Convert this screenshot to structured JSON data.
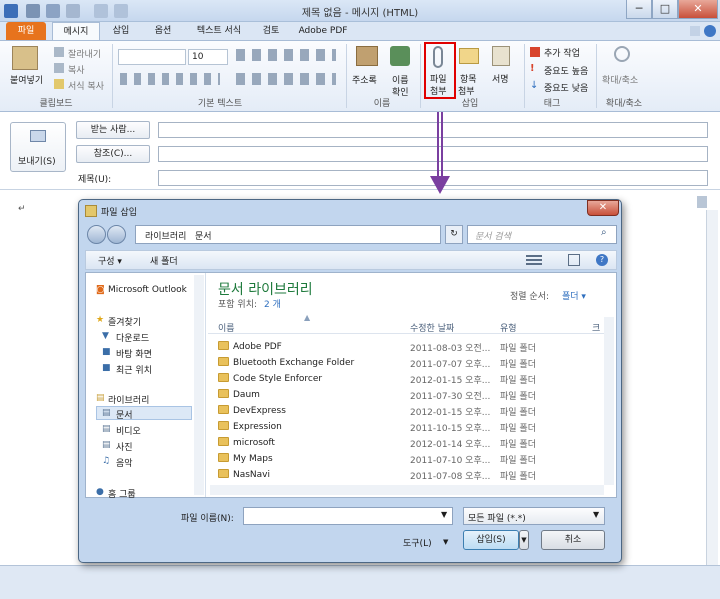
{
  "window": {
    "title": "제목 없음 - 메시지 (HTML)",
    "controls": {
      "minimize": "─",
      "maximize": "□",
      "close": "✕"
    }
  },
  "tabs": [
    "파일",
    "메시지",
    "삽입",
    "옵션",
    "텍스트 서식",
    "검토",
    "Adobe PDF"
  ],
  "ribbon": {
    "clipboard": {
      "paste": "붙여넣기",
      "cut": "잘라내기",
      "copy": "복사",
      "format_painter": "서식 복사",
      "label": "클립보드"
    },
    "basic_text": {
      "font": "",
      "size": "10",
      "label": "기본 텍스트"
    },
    "names": {
      "address_book": "주소록",
      "check_names_1": "이름",
      "check_names_2": "확인",
      "label": "이름"
    },
    "include": {
      "attach_1": "파일",
      "attach_2": "첨부",
      "item_1": "항목",
      "item_2": "첨부",
      "signature": "서명",
      "label": "삽입"
    },
    "tags": {
      "follow_up": "추가 작업",
      "high": "중요도 높음",
      "low": "중요도 낮음",
      "label": "태그"
    },
    "zoom": {
      "zoom": "확대/축소",
      "label": "확대/축소"
    }
  },
  "compose": {
    "send": "보내기(S)",
    "to": "받는 사람...",
    "cc": "참조(C)...",
    "subject": "제목(U):"
  },
  "dialog": {
    "title": "파일 삽입",
    "breadcrumb": [
      "라이브러리",
      "문서"
    ],
    "search_placeholder": "문서 검색",
    "toolbar": {
      "organize": "구성 ▾",
      "new_folder": "새 폴더"
    },
    "nav": {
      "outlook": "Microsoft Outlook",
      "favorites": "즐겨찾기",
      "downloads": "다운로드",
      "desktop": "바탕 화면",
      "recent": "최근 위치",
      "libraries": "라이브러리",
      "documents": "문서",
      "videos": "비디오",
      "pictures": "사진",
      "music": "음악",
      "homegroup": "홈 그룹"
    },
    "library_title": "문서 라이브러리",
    "includes": "포함 위치:",
    "includes_count": "2 개",
    "sort_label": "정렬 순서:",
    "sort_value": "폴더 ▾",
    "columns": [
      "이름",
      "수정한 날짜",
      "유형",
      "크"
    ],
    "files": [
      {
        "name": "Adobe PDF",
        "date": "2011-08-03 오전...",
        "type": "파일 폴더"
      },
      {
        "name": "Bluetooth Exchange Folder",
        "date": "2011-07-07 오후...",
        "type": "파일 폴더"
      },
      {
        "name": "Code Style Enforcer",
        "date": "2012-01-15 오후...",
        "type": "파일 폴더"
      },
      {
        "name": "Daum",
        "date": "2011-07-30 오전...",
        "type": "파일 폴더"
      },
      {
        "name": "DevExpress",
        "date": "2012-01-15 오후...",
        "type": "파일 폴더"
      },
      {
        "name": "Expression",
        "date": "2011-10-15 오후...",
        "type": "파일 폴더"
      },
      {
        "name": "microsoft",
        "date": "2012-01-14 오후...",
        "type": "파일 폴더"
      },
      {
        "name": "My Maps",
        "date": "2011-07-10 오후...",
        "type": "파일 폴더"
      },
      {
        "name": "NasNavi",
        "date": "2011-07-08 오후...",
        "type": "파일 폴더"
      }
    ],
    "filename_label": "파일 이름(N):",
    "filename_value": "",
    "filter": "모든 파일 (*.*)",
    "tools": "도구(L)",
    "insert": "삽입(S)",
    "cancel": "취소"
  },
  "colors": {
    "file_tab": "#e7731d",
    "highlight_box": "#e00000",
    "arrow": "#7a3fa0",
    "library_title": "#1e7a3c"
  }
}
